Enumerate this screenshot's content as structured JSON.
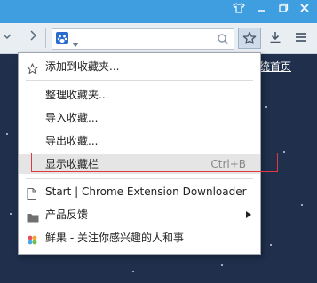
{
  "window_buttons": [
    "shirt-icon",
    "minimize-icon",
    "restore-icon",
    "close-icon"
  ],
  "colors": {
    "titlebar": "#3f9ee0",
    "highlight_border": "#e0383e",
    "menu_bg": "#ffffff"
  },
  "background_link": "统首页",
  "menu": {
    "items": [
      {
        "label": "添加到收藏夹...",
        "icon": "star-outline-icon"
      },
      {
        "label": "整理收藏夹..."
      },
      {
        "label": "导入收藏..."
      },
      {
        "label": "导出收藏..."
      },
      {
        "label": "显示收藏栏",
        "shortcut": "Ctrl+B",
        "highlighted": true
      },
      {
        "label": "Start | Chrome Extension Downloader",
        "icon": "page-icon"
      },
      {
        "label": "产品反馈",
        "icon": "folder-icon",
        "submenu": true
      },
      {
        "label": "鲜果 - 关注你感兴趣的人和事",
        "icon": "xianguo-icon"
      }
    ]
  }
}
